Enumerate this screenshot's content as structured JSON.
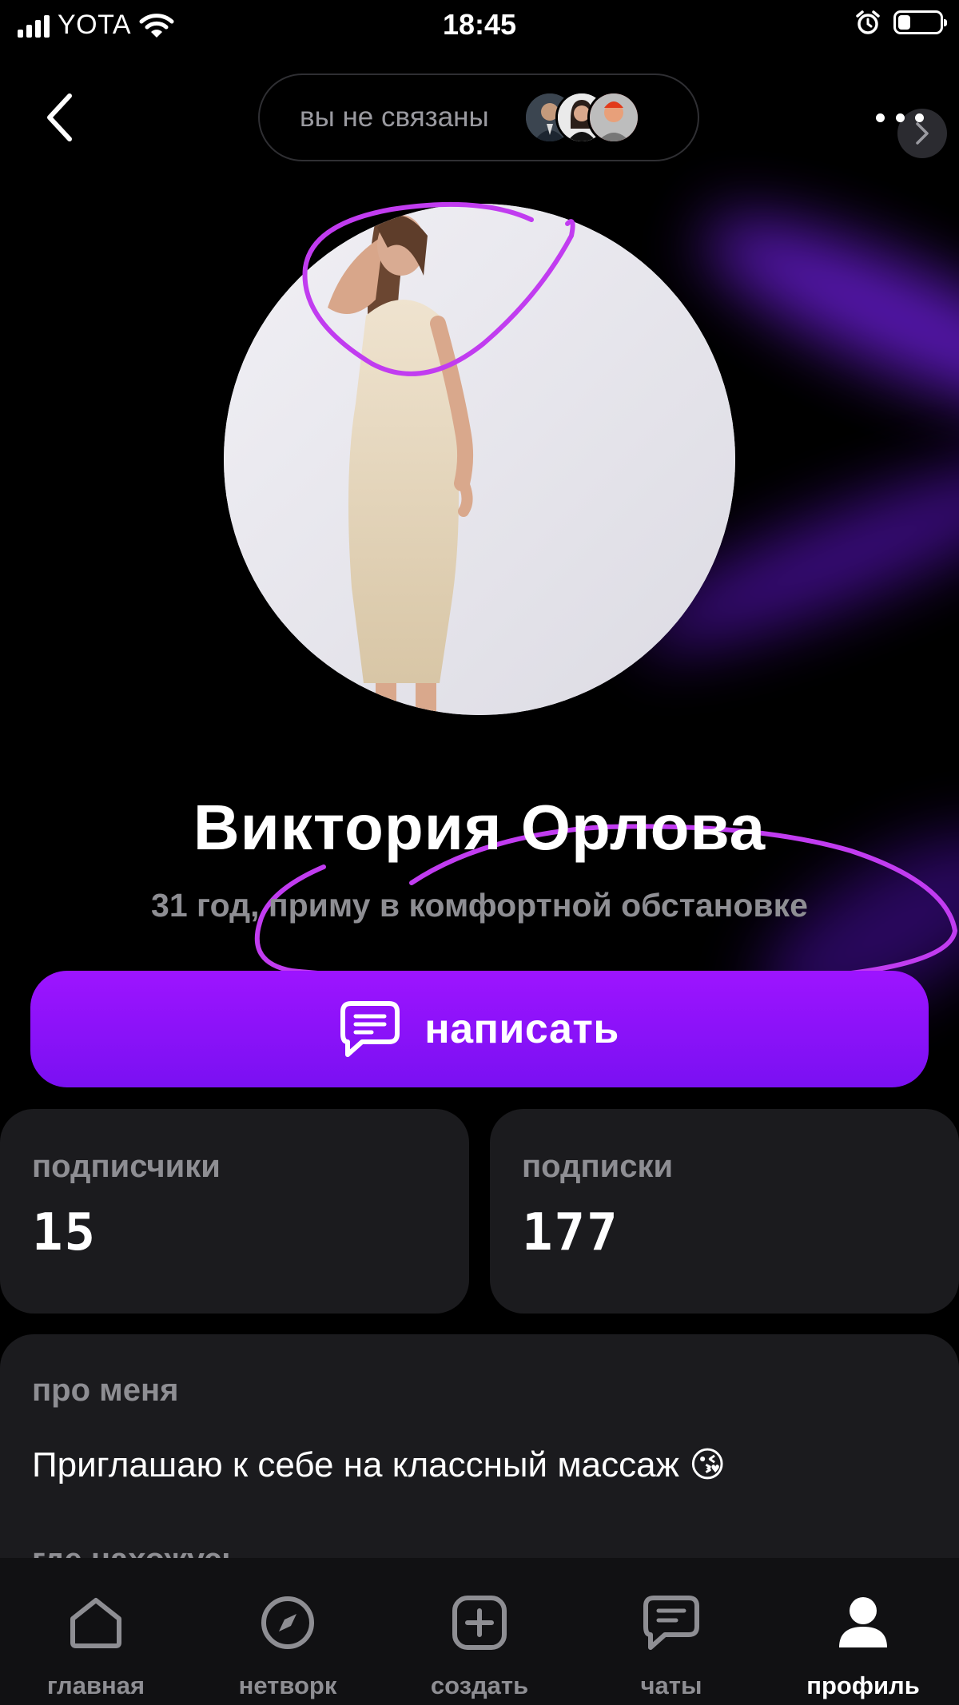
{
  "status_bar": {
    "carrier": "YOTA",
    "time": "18:45",
    "battery_level": 0.3
  },
  "header": {
    "connection_text": "вы не связаны",
    "back_icon": "chevron-left-icon",
    "more_icon": "more-horizontal-icon"
  },
  "profile": {
    "name": "Виктория Орлова",
    "subtitle": "31 год, приму в комфортной обстановке"
  },
  "write_button": {
    "label": "написать",
    "icon": "message-square-icon",
    "gradient_from": "#9d14ff",
    "gradient_to": "#7a10f2"
  },
  "stats": {
    "followers_label": "подписчики",
    "followers_value": "15",
    "following_label": "подписки",
    "following_value": "177"
  },
  "about": {
    "label": "про меня",
    "text": "Приглашаю к себе на классный массаж 😘",
    "location_label": "где нахожусь"
  },
  "tabbar": {
    "items": [
      {
        "label": "главная",
        "icon": "home-icon",
        "active": false
      },
      {
        "label": "нетворк",
        "icon": "compass-icon",
        "active": false
      },
      {
        "label": "создать",
        "icon": "plus-square-icon",
        "active": false
      },
      {
        "label": "чаты",
        "icon": "chat-icon",
        "active": false
      },
      {
        "label": "профиль",
        "icon": "user-icon",
        "active": true
      }
    ]
  },
  "colors": {
    "accent": "#8a12f8",
    "marker": "#c13cf0",
    "card": "#1b1b1e",
    "muted": "#8e8e93"
  }
}
